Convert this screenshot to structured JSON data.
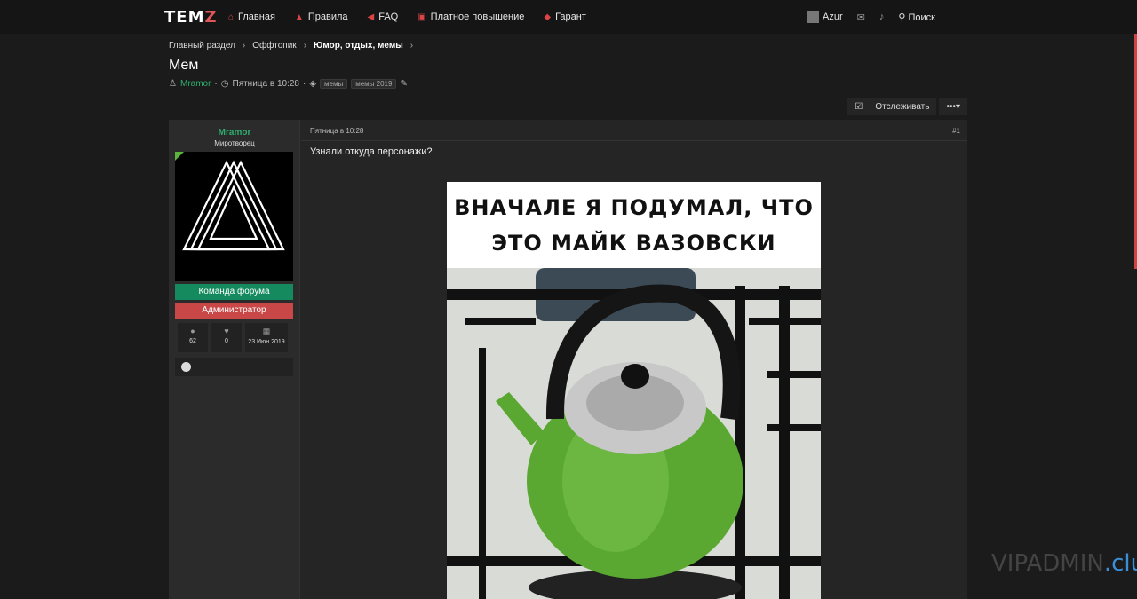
{
  "header": {
    "logo_main": "TEM",
    "logo_accent": "Z",
    "nav": [
      {
        "label": "Главная",
        "icon": "home-icon"
      },
      {
        "label": "Правила",
        "icon": "graduation-cap-icon"
      },
      {
        "label": "FAQ",
        "icon": "bullhorn-icon"
      },
      {
        "label": "Платное повышение",
        "icon": "money-icon"
      },
      {
        "label": "Гарант",
        "icon": "shield-icon"
      }
    ],
    "username": "Azur",
    "search_label": "Поиск"
  },
  "breadcrumbs": [
    "Главный раздел",
    "Оффтопик",
    "Юмор, отдых, мемы"
  ],
  "thread": {
    "title": "Мем",
    "author": "Mramor",
    "date": "Пятница в 10:28",
    "tags": [
      "мемы",
      "мемы 2019"
    ],
    "watch_label": "Отслеживать"
  },
  "post": {
    "user": {
      "name": "Mramor",
      "title": "Миротворец",
      "badge_team": "Команда форума",
      "badge_admin": "Администратор",
      "messages": "62",
      "likes": "0",
      "joined": "23 Июн 2019"
    },
    "time": "Пятница в 10:28",
    "number": "#1",
    "text": "Узнали откуда персонажи?",
    "meme_line1": "ВНАЧАЛЕ Я ПОДУМАЛ, ЧТО",
    "meme_line2": "ЭТО МАЙК ВАЗОВСКИ"
  },
  "watermark": {
    "part1": "VIPADMIN",
    "part2": ".club"
  },
  "colors": {
    "accent_red": "#d94545",
    "user_green": "#2eae6e",
    "badge_team": "#148a5e",
    "badge_admin": "#c94747",
    "kettle_green": "#5aa832"
  }
}
